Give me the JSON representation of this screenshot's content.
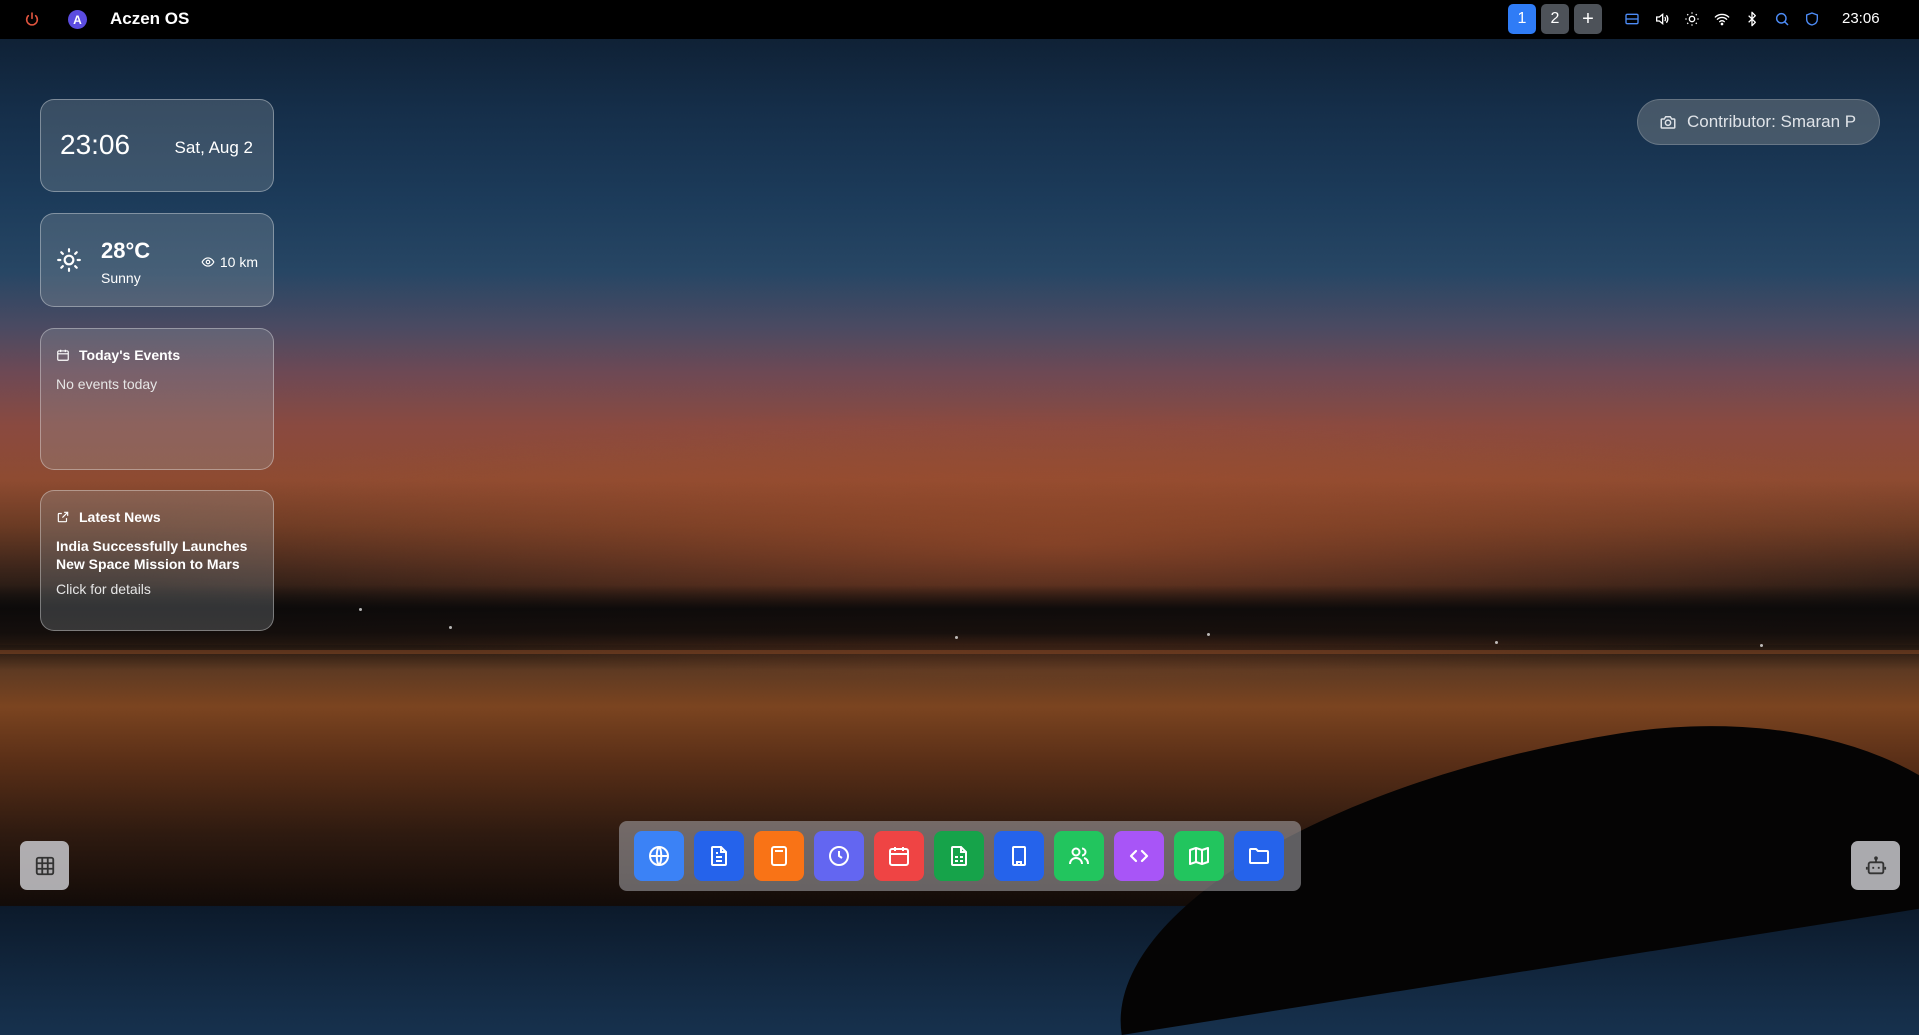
{
  "topbar": {
    "title": "Aczen OS",
    "avatar_letter": "A",
    "workspaces": [
      "1",
      "2"
    ],
    "add_workspace": "+",
    "time": "23:06",
    "tray_icons": [
      "taskbar-icon",
      "volume-icon",
      "brightness-icon",
      "wifi-icon",
      "bluetooth-icon",
      "search-icon",
      "shield-icon"
    ]
  },
  "clock_widget": {
    "time": "23:06",
    "date": "Sat, Aug 2"
  },
  "weather_widget": {
    "temperature": "28°C",
    "condition": "Sunny",
    "visibility": "10 km"
  },
  "events_widget": {
    "title": "Today's Events",
    "empty_text": "No events today"
  },
  "news_widget": {
    "title": "Latest News",
    "headline": "India Successfully Launches New Space Mission to Mars",
    "details": "Click for details"
  },
  "wallpaper": {
    "contributor": "Contributor: Smaran P"
  },
  "dock": {
    "apps": [
      {
        "icon": "globe-icon",
        "color": "#3b82f6"
      },
      {
        "icon": "document-icon",
        "color": "#2563eb"
      },
      {
        "icon": "calculator-icon",
        "color": "#f97316"
      },
      {
        "icon": "clock-icon",
        "color": "#6366f1"
      },
      {
        "icon": "calendar-icon",
        "color": "#ef4444"
      },
      {
        "icon": "spreadsheet-icon",
        "color": "#16a34a"
      },
      {
        "icon": "building-icon",
        "color": "#2563eb"
      },
      {
        "icon": "users-icon",
        "color": "#22c55e"
      },
      {
        "icon": "code-icon",
        "color": "#a855f7"
      },
      {
        "icon": "map-icon",
        "color": "#22c55e"
      },
      {
        "icon": "folder-icon",
        "color": "#2563eb"
      }
    ]
  }
}
